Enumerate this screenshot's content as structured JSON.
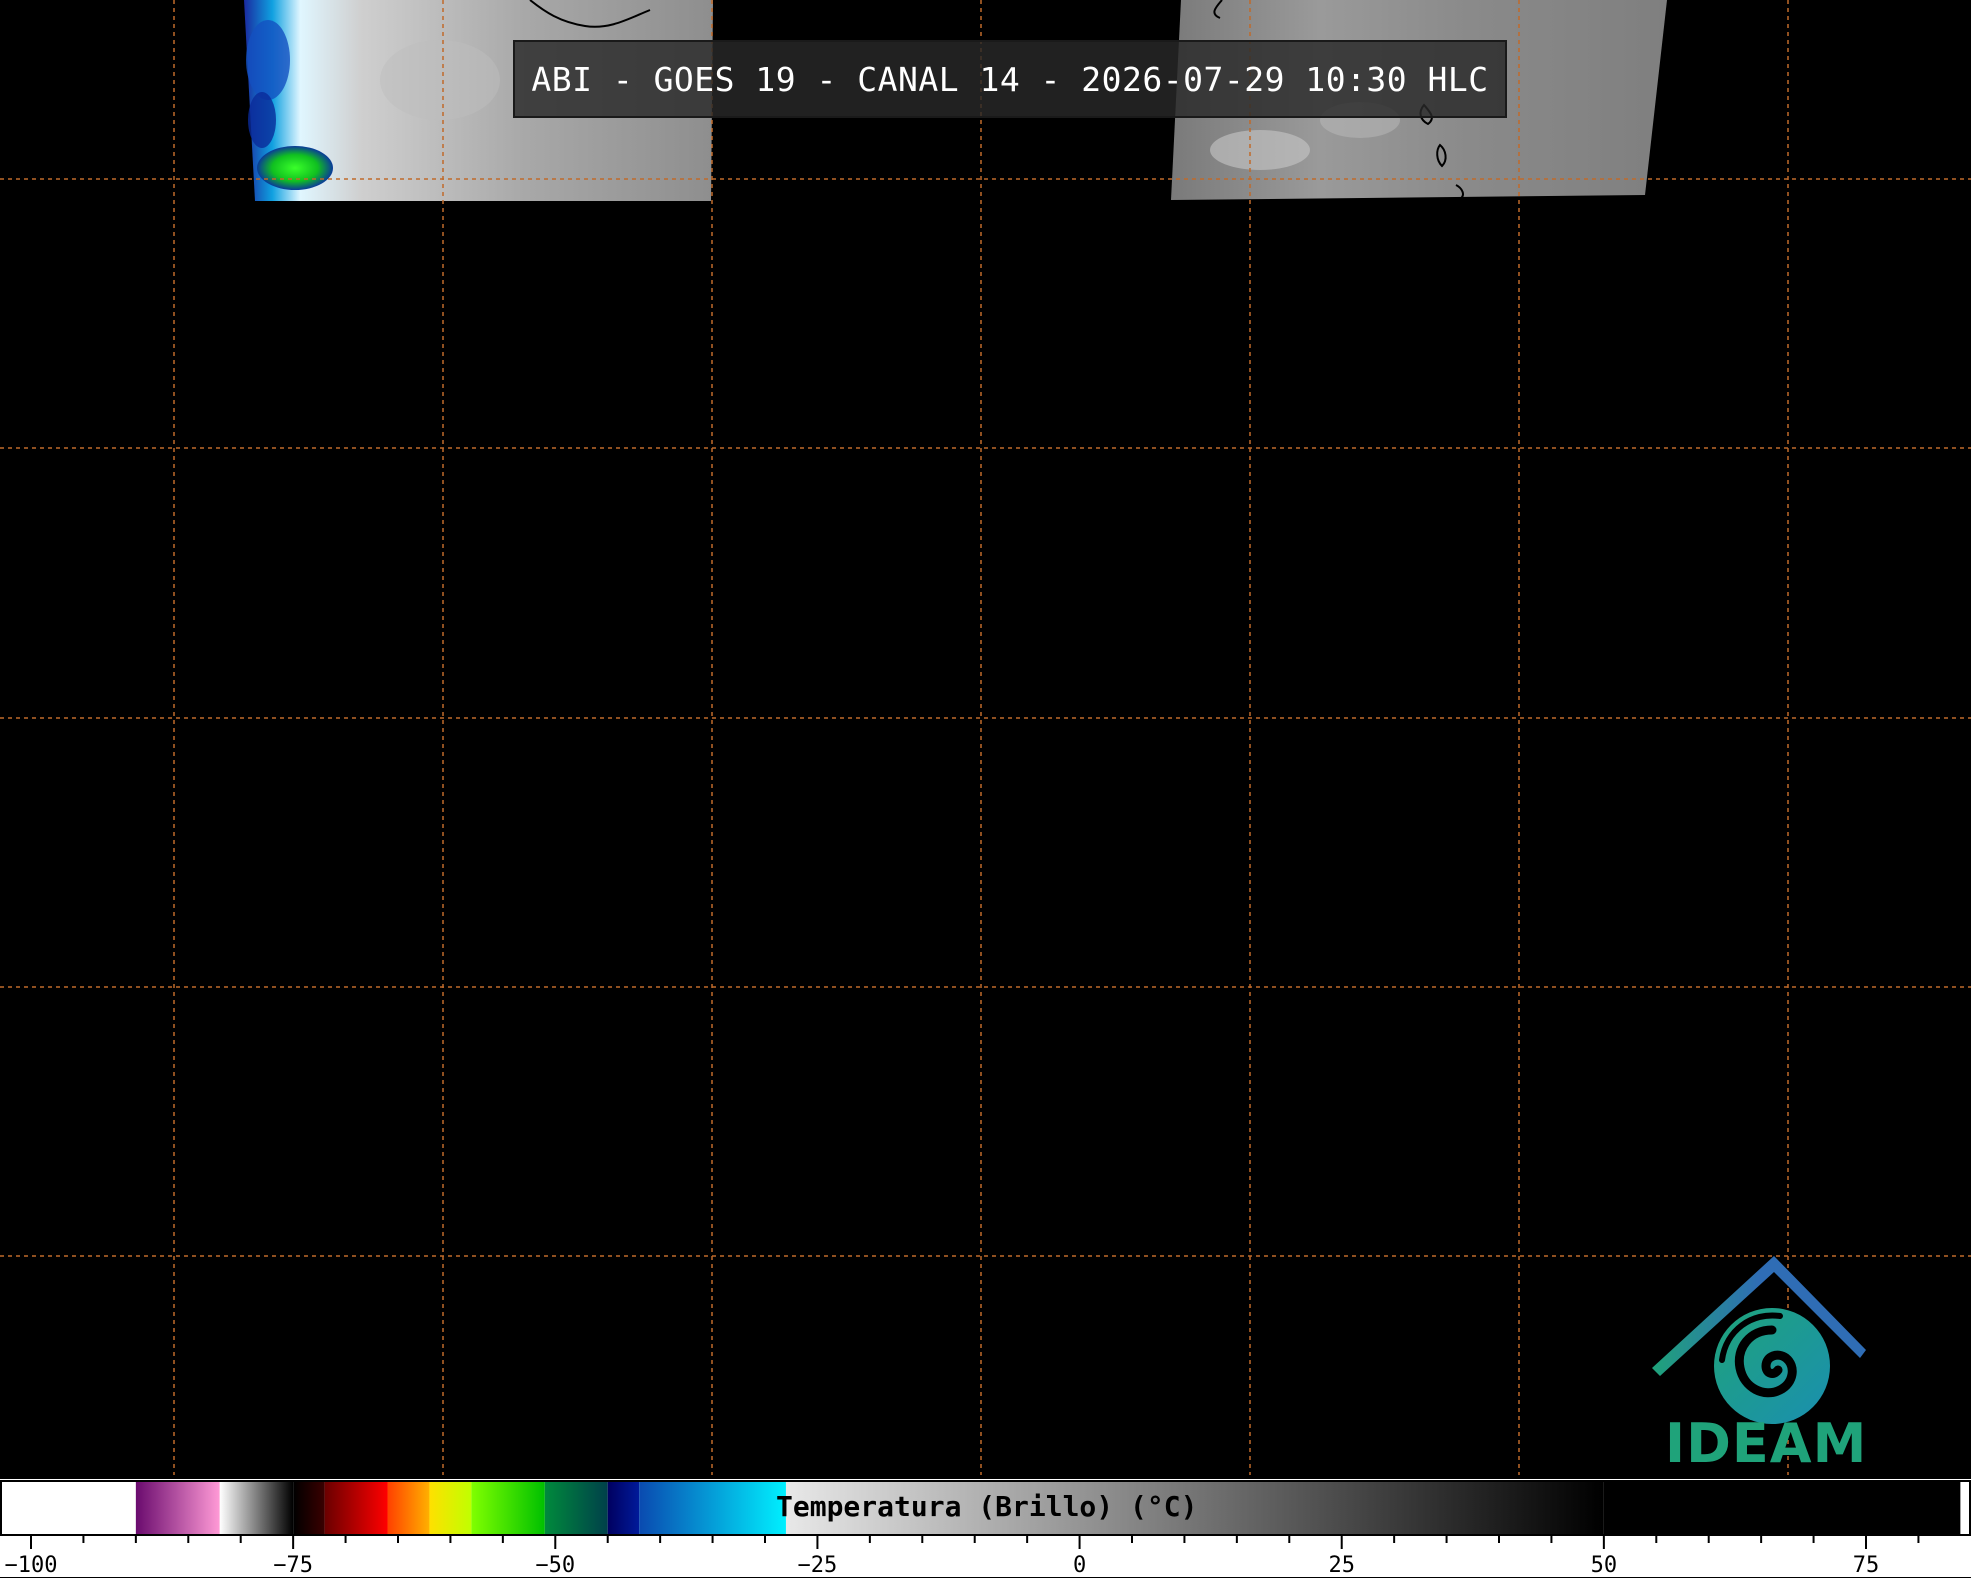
{
  "title": "ABI - GOES 19 - CANAL 14 - 2026-07-29 10:30 HLC",
  "logo": {
    "text": "IDEAM",
    "icon": "ideam-logo-icon"
  },
  "colors": {
    "background": "#000000",
    "grid": "#c06a2a",
    "logo_green": "#1fa37a",
    "logo_blue": "#2f6db5"
  },
  "colorbar": {
    "label": "Temperatura (Brillo) (°C)",
    "min": -102,
    "max": 84,
    "major_ticks": [
      -100,
      -75,
      -50,
      -25,
      0,
      25,
      50,
      75
    ],
    "tick_labels": [
      "−100",
      "−75",
      "−50",
      "−25",
      "0",
      "25",
      "50",
      "75"
    ],
    "segments": [
      {
        "from": -102,
        "to": -90,
        "colors": [
          "#ffffff",
          "#ffffff"
        ]
      },
      {
        "from": -90,
        "to": -82,
        "colors": [
          "#6a0b6e",
          "#ff9ad6"
        ]
      },
      {
        "from": -82,
        "to": -75,
        "colors": [
          "#ffffff",
          "#000000"
        ]
      },
      {
        "from": -75,
        "to": -72,
        "colors": [
          "#000000",
          "#3a0000"
        ]
      },
      {
        "from": -72,
        "to": -66,
        "colors": [
          "#6a0000",
          "#ff0000"
        ]
      },
      {
        "from": -66,
        "to": -62,
        "colors": [
          "#ff4000",
          "#ffb000"
        ]
      },
      {
        "from": -62,
        "to": -58,
        "colors": [
          "#ffe000",
          "#c0ff00"
        ]
      },
      {
        "from": -58,
        "to": -51,
        "colors": [
          "#80ff00",
          "#00c000"
        ]
      },
      {
        "from": -51,
        "to": -45,
        "colors": [
          "#008a3c",
          "#00404a"
        ]
      },
      {
        "from": -45,
        "to": -42,
        "colors": [
          "#000060",
          "#001a9a"
        ]
      },
      {
        "from": -42,
        "to": -28,
        "colors": [
          "#0a4ab0",
          "#00f0ff"
        ]
      },
      {
        "from": -28,
        "to": 50,
        "colors": [
          "#e8e8e8",
          "#000000"
        ]
      },
      {
        "from": 50,
        "to": 84,
        "colors": [
          "#000000",
          "#000000"
        ]
      }
    ]
  }
}
